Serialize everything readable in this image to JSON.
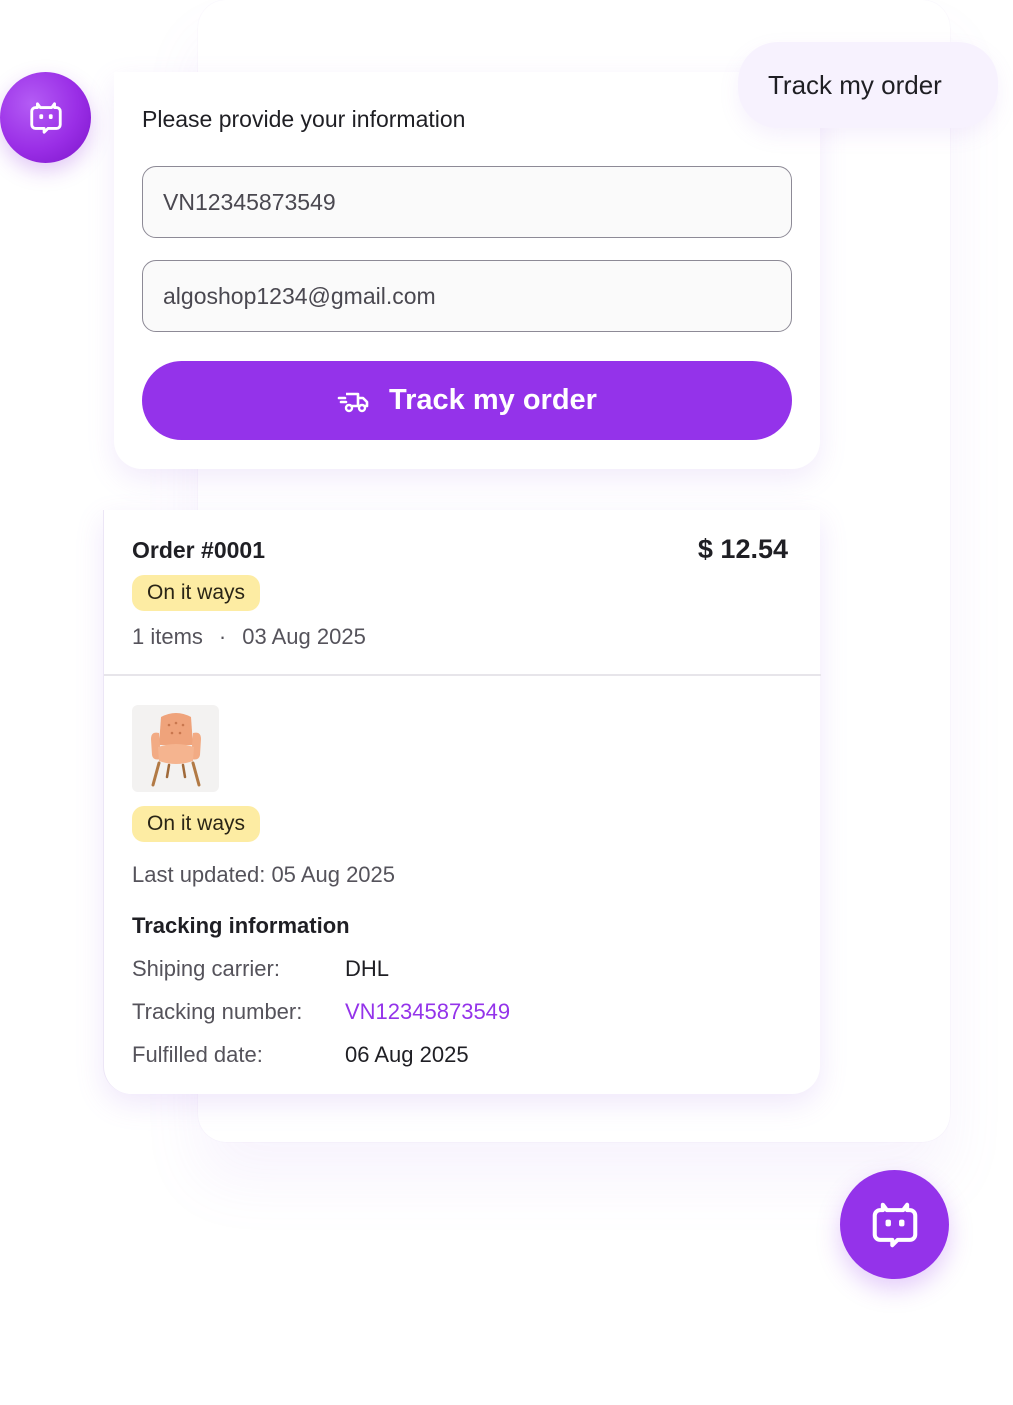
{
  "user_message": "Track my order",
  "form": {
    "prompt": "Please provide your information",
    "order_number_value": "VN12345873549",
    "email_value": "algoshop1234@gmail.com",
    "submit_label": "Track my order",
    "submit_icon": "delivery-truck-icon"
  },
  "order": {
    "title": "Order #0001",
    "total": "$ 12.54",
    "status": "On it ways",
    "items_count": "1 items",
    "separator": "·",
    "date": "03 Aug 2025"
  },
  "shipment": {
    "product_image": "armchair-image",
    "status": "On it ways",
    "last_updated": "Last updated: 05 Aug 2025",
    "heading": "Tracking information",
    "rows": [
      {
        "label": "Shiping carrier:",
        "value": "DHL"
      },
      {
        "label": "Tracking number:",
        "value": "VN12345873549"
      },
      {
        "label": "Fulfilled date:",
        "value": "06 Aug 2025"
      }
    ]
  },
  "icons": {
    "bot": "bot-face-icon",
    "launcher": "chat-bot-launcher-icon"
  },
  "colors": {
    "accent": "#9433ea",
    "badge_bg": "#fdeca3",
    "bubble_bg": "#f7f2fe",
    "link": "#9433ea"
  }
}
